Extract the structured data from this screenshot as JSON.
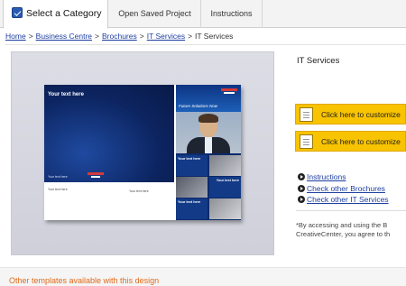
{
  "tabs": {
    "select_category": "Select a Category",
    "open_saved_project": "Open Saved Project",
    "instructions": "Instructions"
  },
  "breadcrumb": {
    "home": "Home",
    "business_centre": "Business Centre",
    "brochures": "Brochures",
    "it_services_link": "IT Services",
    "current": "IT Services",
    "separator": ">"
  },
  "preview": {
    "your_text_here_big": "Your text here",
    "future_solutions": "Future Solutions Now",
    "cell_text": "Your text here",
    "your_text_here_small": "Your text here",
    "bottom_text_1": "Your text here",
    "bottom_text_2": "Your text here"
  },
  "product": {
    "title": "IT Services",
    "customize_button_1": "Click here to customize",
    "customize_button_2": "Click here to customize"
  },
  "links": {
    "instructions": "Instructions",
    "check_other_brochures": "Check other Brochures",
    "check_other_it_services": "Check other IT Services"
  },
  "disclaimer": {
    "line1": "*By accessing and using the B",
    "line2": "CreativeCenter, you agree to th"
  },
  "footer": {
    "other_templates": "Other templates available with this design"
  },
  "colors": {
    "customize_button_bg": "#f8c300",
    "link": "#1c3ea0",
    "other_templates_text": "#e06a1a",
    "brochure_blue": "#0d2a6b"
  }
}
